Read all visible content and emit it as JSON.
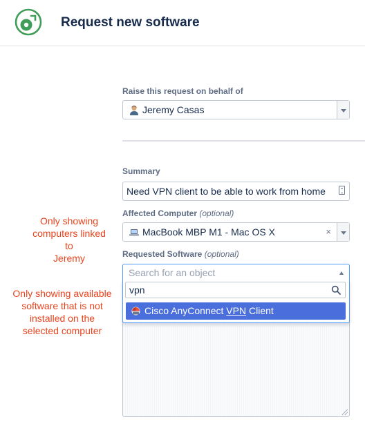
{
  "header": {
    "title": "Request new software",
    "logo_icon": "software-disc-icon"
  },
  "form": {
    "on_behalf": {
      "label": "Raise this request on behalf of",
      "value": "Jeremy Casas",
      "avatar_icon": "user-avatar-icon"
    },
    "summary": {
      "label": "Summary",
      "value": "Need VPN client to be able to work from home"
    },
    "affected_computer": {
      "label": "Affected Computer",
      "optional": "(optional)",
      "value": "MacBook MBP M1 - Mac OS X",
      "clear_symbol": "×"
    },
    "requested_software": {
      "label": "Requested Software",
      "optional": "(optional)",
      "placeholder": "Search for an object",
      "search_value": "vpn",
      "results": [
        {
          "prefix": "Cisco AnyConnect ",
          "match": "VPN",
          "suffix": " Client"
        }
      ]
    }
  },
  "annotations": {
    "computers": [
      "Only showing",
      "computers linked to",
      "Jeremy"
    ],
    "software": [
      "Only showing available",
      "software that is not",
      "installed on the",
      "selected computer"
    ]
  },
  "colors": {
    "annotation": "#e8431d",
    "logo": "#3f9d58",
    "selected_row": "#4a6fdc",
    "focus_border": "#4c9aff"
  }
}
